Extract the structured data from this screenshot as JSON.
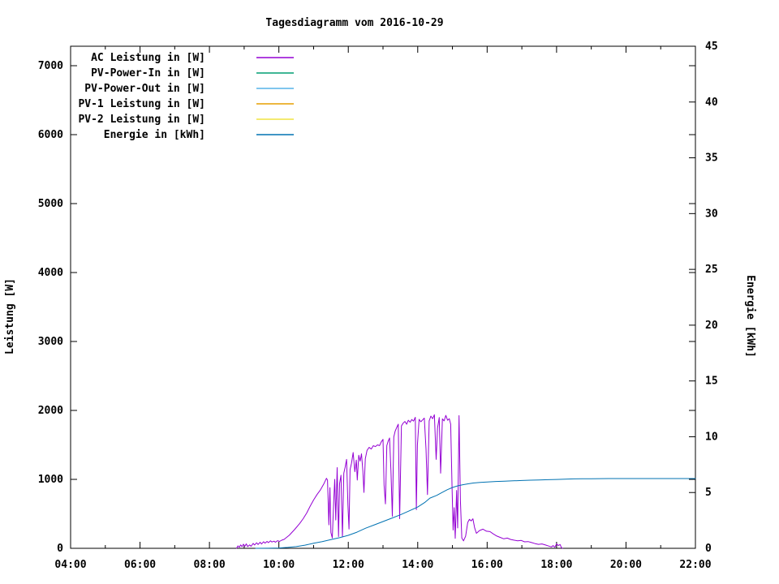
{
  "window": {
    "title": "Tagesdiagramm vom 2016-10-29"
  },
  "colors": {
    "background": "#ffffff",
    "frame": "#000000",
    "ac_power": "#9400d3",
    "pv_power_in": "#009e73",
    "pv_power_out": "#56b4e9",
    "pv1_power": "#e69f00",
    "pv2_power": "#f0e442",
    "energy": "#0072b2"
  },
  "chart_data": {
    "type": "line",
    "title": "Tagesdiagramm vom 2016-10-29",
    "grid": false,
    "legend_position": "top-left-inside",
    "x_axis": {
      "label": "",
      "range_hours": [
        4,
        22
      ],
      "major_tick_labels": [
        "04:00",
        "06:00",
        "08:00",
        "10:00",
        "12:00",
        "14:00",
        "16:00",
        "18:00",
        "20:00",
        "22:00"
      ],
      "major_tick_hours": [
        4,
        6,
        8,
        10,
        12,
        14,
        16,
        18,
        20,
        22
      ],
      "minor_tick_hours": [
        5,
        7,
        9,
        11,
        13,
        15,
        17,
        19,
        21
      ]
    },
    "y_left": {
      "label": "Leistung [W]",
      "tick_values": [
        0,
        1000,
        2000,
        3000,
        4000,
        5000,
        6000,
        7000
      ],
      "tick_labels": [
        "0",
        "1000",
        "2000",
        "3000",
        "4000",
        "5000",
        "6000",
        "7000"
      ],
      "range": [
        0,
        7280
      ]
    },
    "y_right": {
      "label": "Energie [kWh]",
      "tick_values": [
        0,
        5,
        10,
        15,
        20,
        25,
        30,
        35,
        40,
        45
      ],
      "tick_labels": [
        "0",
        "5",
        "10",
        "15",
        "20",
        "25",
        "30",
        "35",
        "40",
        "45"
      ],
      "range": [
        0,
        45
      ]
    },
    "legend": [
      {
        "label": "AC Leistung in [W]",
        "color": "#9400d3"
      },
      {
        "label": "PV-Power-In in [W]",
        "color": "#009e73"
      },
      {
        "label": "PV-Power-Out in [W]",
        "color": "#56b4e9"
      },
      {
        "label": "PV-1 Leistung in [W]",
        "color": "#e69f00"
      },
      {
        "label": "PV-2 Leistung in [W]",
        "color": "#f0e442"
      },
      {
        "label": "Energie in [kWh]",
        "color": "#0072b2"
      }
    ],
    "series": [
      {
        "name": "AC Leistung in [W]",
        "key": "ac-leistung",
        "color": "#9400d3",
        "axis": "left",
        "points": [
          [
            8.78,
            0
          ],
          [
            8.82,
            35
          ],
          [
            8.86,
            15
          ],
          [
            8.9,
            50
          ],
          [
            8.94,
            25
          ],
          [
            8.98,
            60
          ],
          [
            9.02,
            30
          ],
          [
            9.06,
            65
          ],
          [
            9.1,
            25
          ],
          [
            9.16,
            50
          ],
          [
            9.2,
            30
          ],
          [
            9.26,
            72
          ],
          [
            9.3,
            48
          ],
          [
            9.36,
            80
          ],
          [
            9.4,
            55
          ],
          [
            9.46,
            88
          ],
          [
            9.5,
            62
          ],
          [
            9.56,
            95
          ],
          [
            9.6,
            75
          ],
          [
            9.66,
            100
          ],
          [
            9.7,
            82
          ],
          [
            9.76,
            108
          ],
          [
            9.8,
            92
          ],
          [
            9.86,
            104
          ],
          [
            9.9,
            88
          ],
          [
            9.96,
            110
          ],
          [
            10.02,
            100
          ],
          [
            10.08,
            118
          ],
          [
            10.15,
            130
          ],
          [
            10.3,
            190
          ],
          [
            10.45,
            270
          ],
          [
            10.6,
            360
          ],
          [
            10.7,
            430
          ],
          [
            10.8,
            510
          ],
          [
            10.9,
            610
          ],
          [
            11.0,
            700
          ],
          [
            11.1,
            780
          ],
          [
            11.2,
            850
          ],
          [
            11.3,
            940
          ],
          [
            11.37,
            1015
          ],
          [
            11.4,
            990
          ],
          [
            11.44,
            340
          ],
          [
            11.47,
            880
          ],
          [
            11.5,
            230
          ],
          [
            11.54,
            150
          ],
          [
            11.58,
            690
          ],
          [
            11.61,
            1000
          ],
          [
            11.64,
            410
          ],
          [
            11.68,
            1170
          ],
          [
            11.72,
            170
          ],
          [
            11.75,
            940
          ],
          [
            11.79,
            1060
          ],
          [
            11.83,
            165
          ],
          [
            11.87,
            1090
          ],
          [
            11.91,
            1180
          ],
          [
            11.95,
            1290
          ],
          [
            11.99,
            620
          ],
          [
            12.02,
            280
          ],
          [
            12.05,
            1140
          ],
          [
            12.09,
            1230
          ],
          [
            12.14,
            1390
          ],
          [
            12.19,
            1110
          ],
          [
            12.23,
            1280
          ],
          [
            12.26,
            990
          ],
          [
            12.3,
            1350
          ],
          [
            12.34,
            1265
          ],
          [
            12.38,
            1370
          ],
          [
            12.42,
            1120
          ],
          [
            12.45,
            810
          ],
          [
            12.49,
            1300
          ],
          [
            12.54,
            1420
          ],
          [
            12.6,
            1465
          ],
          [
            12.66,
            1440
          ],
          [
            12.72,
            1488
          ],
          [
            12.78,
            1475
          ],
          [
            12.84,
            1500
          ],
          [
            12.9,
            1490
          ],
          [
            12.95,
            1545
          ],
          [
            13.0,
            1580
          ],
          [
            13.03,
            920
          ],
          [
            13.07,
            645
          ],
          [
            13.11,
            1490
          ],
          [
            13.15,
            1555
          ],
          [
            13.19,
            1600
          ],
          [
            13.23,
            1120
          ],
          [
            13.27,
            465
          ],
          [
            13.31,
            1615
          ],
          [
            13.35,
            1700
          ],
          [
            13.4,
            1758
          ],
          [
            13.44,
            1800
          ],
          [
            13.48,
            430
          ],
          [
            13.53,
            1775
          ],
          [
            13.58,
            1815
          ],
          [
            13.63,
            1840
          ],
          [
            13.68,
            1800
          ],
          [
            13.73,
            1858
          ],
          [
            13.78,
            1828
          ],
          [
            13.83,
            1868
          ],
          [
            13.88,
            1845
          ],
          [
            13.93,
            1900
          ],
          [
            13.96,
            560
          ],
          [
            13.99,
            1500
          ],
          [
            14.04,
            1870
          ],
          [
            14.09,
            1835
          ],
          [
            14.14,
            1862
          ],
          [
            14.19,
            1888
          ],
          [
            14.24,
            1440
          ],
          [
            14.28,
            780
          ],
          [
            14.33,
            1850
          ],
          [
            14.38,
            1918
          ],
          [
            14.43,
            1880
          ],
          [
            14.48,
            1938
          ],
          [
            14.53,
            1290
          ],
          [
            14.57,
            1745
          ],
          [
            14.62,
            1898
          ],
          [
            14.66,
            1090
          ],
          [
            14.71,
            1878
          ],
          [
            14.76,
            1848
          ],
          [
            14.81,
            1928
          ],
          [
            14.86,
            1858
          ],
          [
            14.91,
            1880
          ],
          [
            14.95,
            1800
          ],
          [
            14.99,
            880
          ],
          [
            15.02,
            265
          ],
          [
            15.05,
            590
          ],
          [
            15.08,
            145
          ],
          [
            15.12,
            840
          ],
          [
            15.15,
            295
          ],
          [
            15.19,
            1925
          ],
          [
            15.23,
            690
          ],
          [
            15.27,
            150
          ],
          [
            15.32,
            108
          ],
          [
            15.38,
            175
          ],
          [
            15.44,
            375
          ],
          [
            15.49,
            420
          ],
          [
            15.54,
            398
          ],
          [
            15.59,
            428
          ],
          [
            15.64,
            298
          ],
          [
            15.69,
            218
          ],
          [
            15.78,
            258
          ],
          [
            15.88,
            278
          ],
          [
            15.98,
            248
          ],
          [
            16.08,
            242
          ],
          [
            16.18,
            208
          ],
          [
            16.28,
            178
          ],
          [
            16.38,
            158
          ],
          [
            16.48,
            138
          ],
          [
            16.58,
            148
          ],
          [
            16.68,
            128
          ],
          [
            16.78,
            118
          ],
          [
            16.88,
            108
          ],
          [
            16.98,
            114
          ],
          [
            17.08,
            94
          ],
          [
            17.18,
            98
          ],
          [
            17.28,
            84
          ],
          [
            17.38,
            68
          ],
          [
            17.48,
            58
          ],
          [
            17.58,
            63
          ],
          [
            17.68,
            48
          ],
          [
            17.78,
            32
          ],
          [
            17.85,
            20
          ],
          [
            17.9,
            40
          ],
          [
            17.95,
            15
          ],
          [
            18.0,
            65
          ],
          [
            18.05,
            40
          ],
          [
            18.1,
            55
          ],
          [
            18.14,
            10
          ],
          [
            18.17,
            0
          ]
        ]
      },
      {
        "name": "PV-Power-In in [W]",
        "key": "pv-power-in",
        "color": "#009e73",
        "axis": "left",
        "points": []
      },
      {
        "name": "PV-Power-Out in [W]",
        "key": "pv-power-out",
        "color": "#56b4e9",
        "axis": "left",
        "points": []
      },
      {
        "name": "PV-1 Leistung in [W]",
        "key": "pv1-leistung",
        "color": "#e69f00",
        "axis": "left",
        "points": []
      },
      {
        "name": "PV-2 Leistung in [W]",
        "key": "pv2-leistung",
        "color": "#f0e442",
        "axis": "left",
        "points": []
      },
      {
        "name": "Energie in [kWh]",
        "key": "energie",
        "color": "#0072b2",
        "axis": "right",
        "points": [
          [
            9.33,
            0
          ],
          [
            9.7,
            0.01
          ],
          [
            10.0,
            0.03
          ],
          [
            10.25,
            0.08
          ],
          [
            10.5,
            0.15
          ],
          [
            10.75,
            0.28
          ],
          [
            11.0,
            0.45
          ],
          [
            11.25,
            0.6
          ],
          [
            11.5,
            0.78
          ],
          [
            11.75,
            0.95
          ],
          [
            12.0,
            1.16
          ],
          [
            12.25,
            1.45
          ],
          [
            12.5,
            1.8
          ],
          [
            12.75,
            2.1
          ],
          [
            13.0,
            2.4
          ],
          [
            13.25,
            2.7
          ],
          [
            13.5,
            3.0
          ],
          [
            13.75,
            3.35
          ],
          [
            14.0,
            3.7
          ],
          [
            14.2,
            4.1
          ],
          [
            14.35,
            4.5
          ],
          [
            14.55,
            4.75
          ],
          [
            14.7,
            5.0
          ],
          [
            14.85,
            5.25
          ],
          [
            15.0,
            5.45
          ],
          [
            15.15,
            5.6
          ],
          [
            15.3,
            5.7
          ],
          [
            15.45,
            5.78
          ],
          [
            15.6,
            5.85
          ],
          [
            15.8,
            5.91
          ],
          [
            16.0,
            5.95
          ],
          [
            16.25,
            5.99
          ],
          [
            16.5,
            6.02
          ],
          [
            16.75,
            6.05
          ],
          [
            17.0,
            6.08
          ],
          [
            17.25,
            6.11
          ],
          [
            17.5,
            6.13
          ],
          [
            17.75,
            6.15
          ],
          [
            18.0,
            6.17
          ],
          [
            18.25,
            6.2
          ],
          [
            18.5,
            6.22
          ],
          [
            18.75,
            6.23
          ],
          [
            19.0,
            6.24
          ],
          [
            19.5,
            6.25
          ],
          [
            20.0,
            6.25
          ],
          [
            20.5,
            6.25
          ],
          [
            21.0,
            6.25
          ],
          [
            21.5,
            6.25
          ],
          [
            22.0,
            6.25
          ]
        ]
      }
    ]
  }
}
